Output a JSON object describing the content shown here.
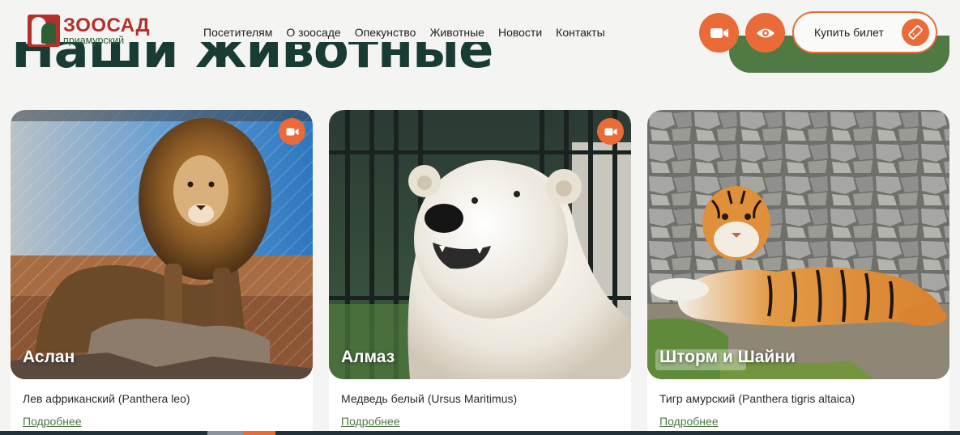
{
  "logo": {
    "line1": "ЗООСАД",
    "line2": "приамурский"
  },
  "page": {
    "heading": "Наши животные"
  },
  "nav": {
    "items": [
      {
        "label": "Посетителям"
      },
      {
        "label": "О зоосаде"
      },
      {
        "label": "Опекунство"
      },
      {
        "label": "Животные"
      },
      {
        "label": "Новости"
      },
      {
        "label": "Контакты"
      }
    ]
  },
  "actions": {
    "video_icon": "video-camera-icon",
    "eye_icon": "eye-icon",
    "ticket_label": "Купить билет",
    "ticket_icon": "ticket-icon"
  },
  "animals": [
    {
      "name": "Аслан",
      "species": "Лев африканский (Panthera leo)",
      "more": "Подробнее",
      "has_camera": true
    },
    {
      "name": "Алмаз",
      "species": "Медведь белый (Ursus Maritimus)",
      "more": "Подробнее",
      "has_camera": true
    },
    {
      "name": "Шторм и Шайни",
      "species": "Тигр амурский (Panthera tigris altaica)",
      "more": "Подробнее",
      "has_camera": false
    }
  ],
  "colors": {
    "accent": "#ea6b38",
    "brand_green": "#4f7a44",
    "brand_red": "#b3302b",
    "dark_green": "#183c33"
  }
}
